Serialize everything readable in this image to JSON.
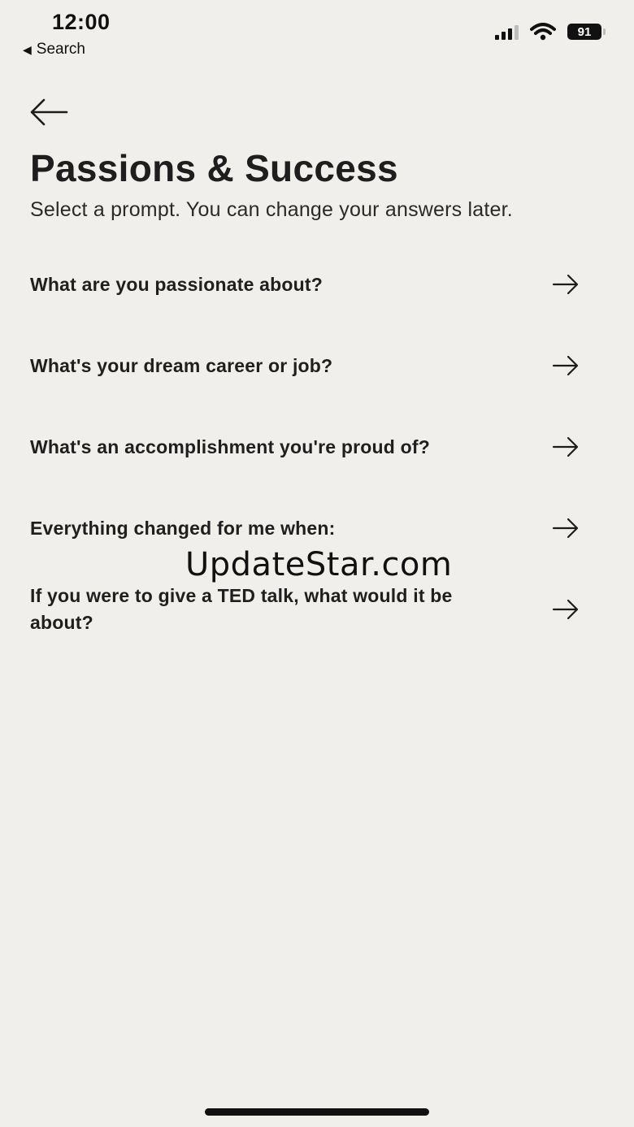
{
  "status_bar": {
    "time": "12:00",
    "back_label": "Search",
    "battery": "91"
  },
  "header": {
    "title": "Passions & Success",
    "subtitle": "Select a prompt. You can change your answers later."
  },
  "prompts": [
    "What are you passionate about?",
    "What's your dream career or job?",
    "What's an accomplishment you're proud of?",
    "Everything changed for me when:",
    "If you were to give a TED talk, what would it be about?"
  ],
  "watermark": "UpdateStar.com",
  "icons": {
    "back": "arrow-left-icon",
    "row": "arrow-right-icon"
  }
}
